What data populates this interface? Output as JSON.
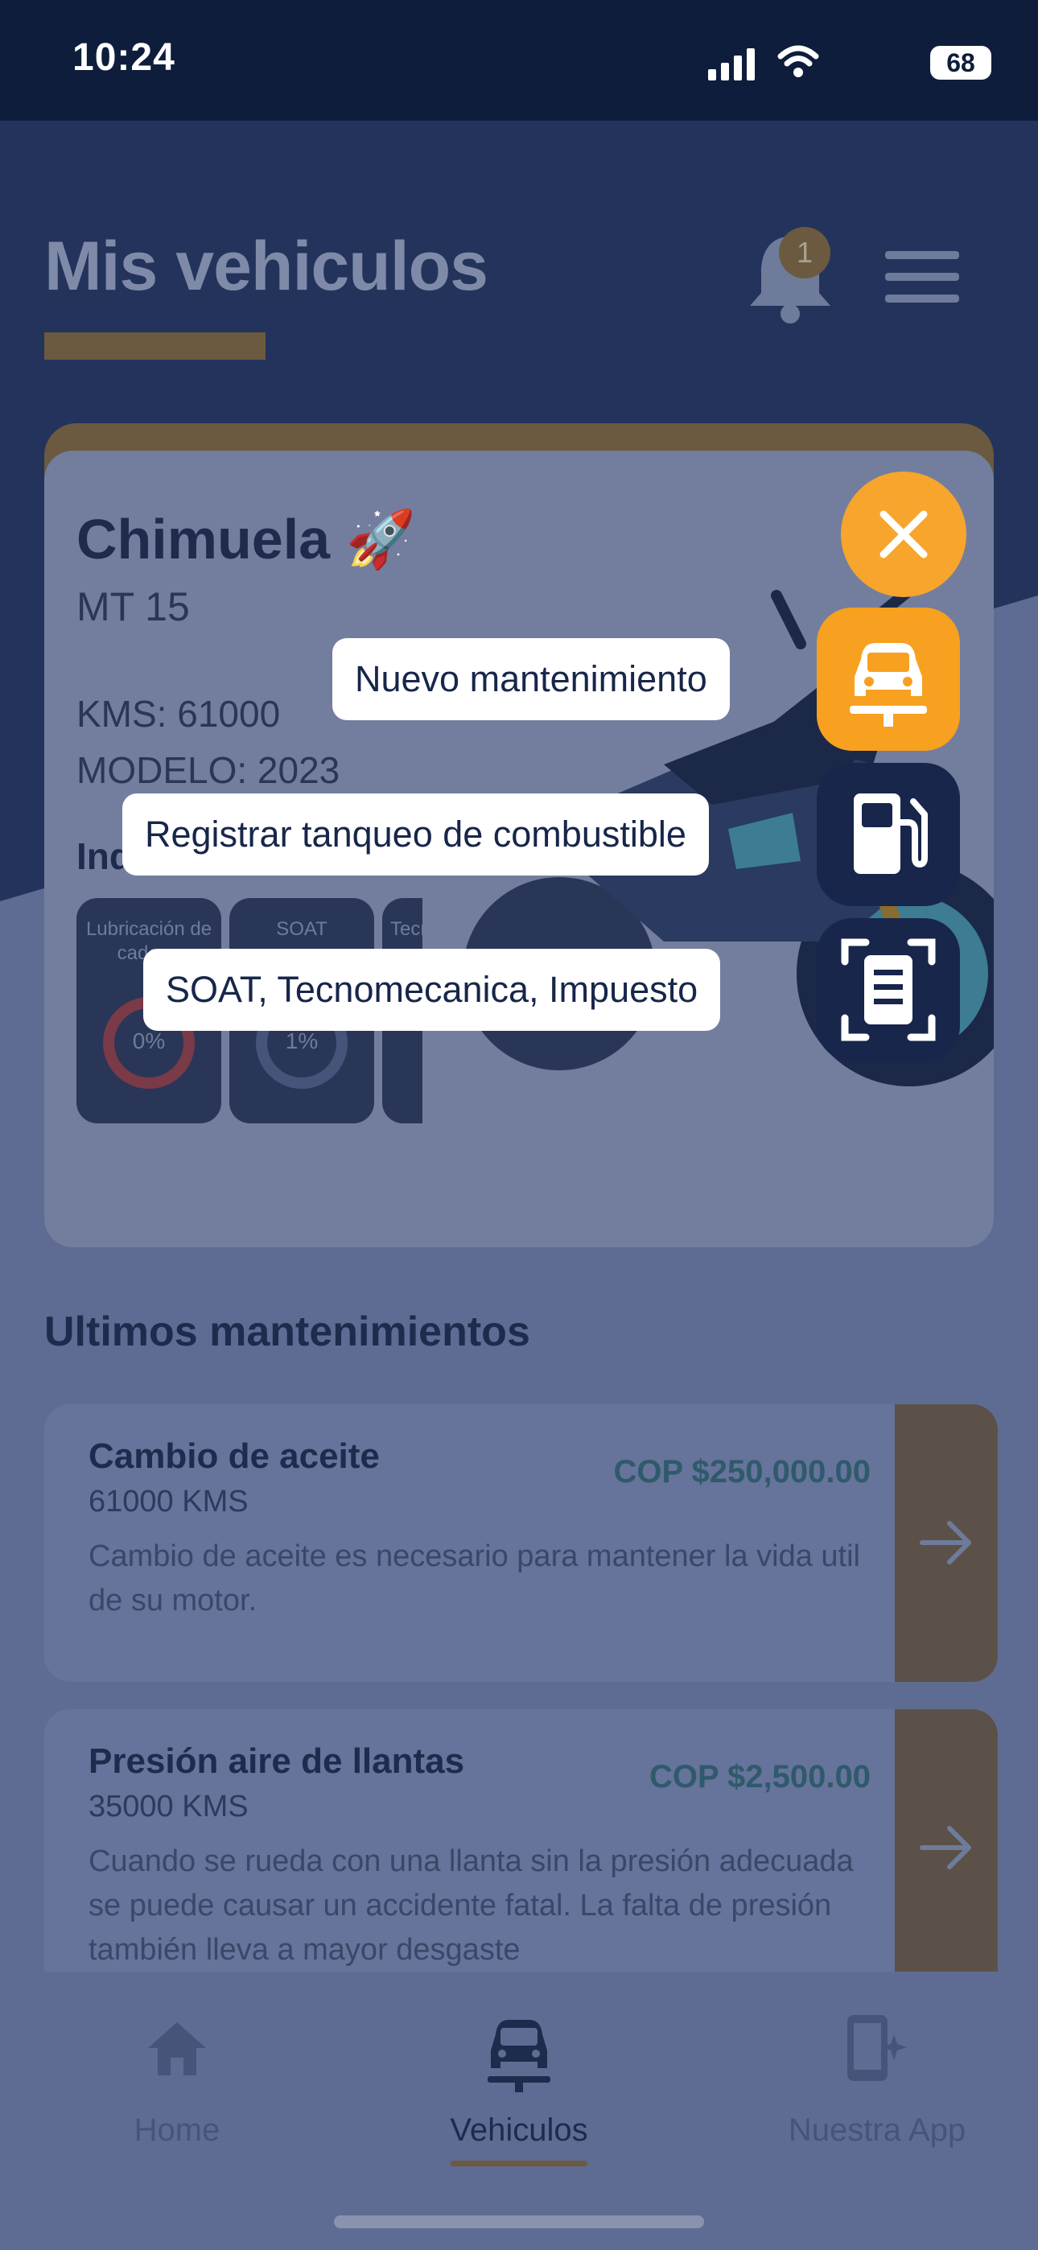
{
  "status_bar": {
    "time": "10:24",
    "battery": "68"
  },
  "header": {
    "title": "Mis vehiculos",
    "notification_count": "1"
  },
  "vehicle": {
    "name": "Chimuela 🚀",
    "model": "MT 15",
    "kms": "KMS: 61000",
    "year": "MODELO: 2023",
    "indicators_title": "Indicadores",
    "gauges": [
      {
        "label": "Lubricación de cadena",
        "value": "0%"
      },
      {
        "label": "SOAT",
        "value": "1%"
      },
      {
        "label": "Tecnomecanica",
        "value": ""
      }
    ]
  },
  "maintenance": {
    "title": "Ultimos mantenimientos",
    "items": [
      {
        "title": "Cambio de aceite",
        "kms": "61000 KMS",
        "price": "COP $250,000.00",
        "description": "Cambio de aceite es necesario para mantener la vida util de su motor."
      },
      {
        "title": "Presión aire de llantas",
        "kms": "35000 KMS",
        "price": "COP $2,500.00",
        "description": "Cuando se rueda con una llanta sin la presión adecuada se puede causar un accidente fatal. La falta de presión también lleva a mayor desgaste"
      }
    ]
  },
  "fab_menu": {
    "options": [
      {
        "label": "Nuevo mantenimiento",
        "icon": "car-lift-icon"
      },
      {
        "label": "Registrar tanqueo de combustible",
        "icon": "fuel-pump-icon"
      },
      {
        "label": "SOAT, Tecnomecanica, Impuesto",
        "icon": "document-scan-icon"
      }
    ],
    "colors": {
      "primary": "#f8a01f",
      "secondary": "#17264a"
    }
  },
  "tab_bar": {
    "tabs": [
      {
        "label": "Home",
        "icon": "home-icon"
      },
      {
        "label": "Vehiculos",
        "icon": "car-icon",
        "active": true
      },
      {
        "label": "Nuestra App",
        "icon": "phone-sparkle-icon"
      }
    ]
  }
}
